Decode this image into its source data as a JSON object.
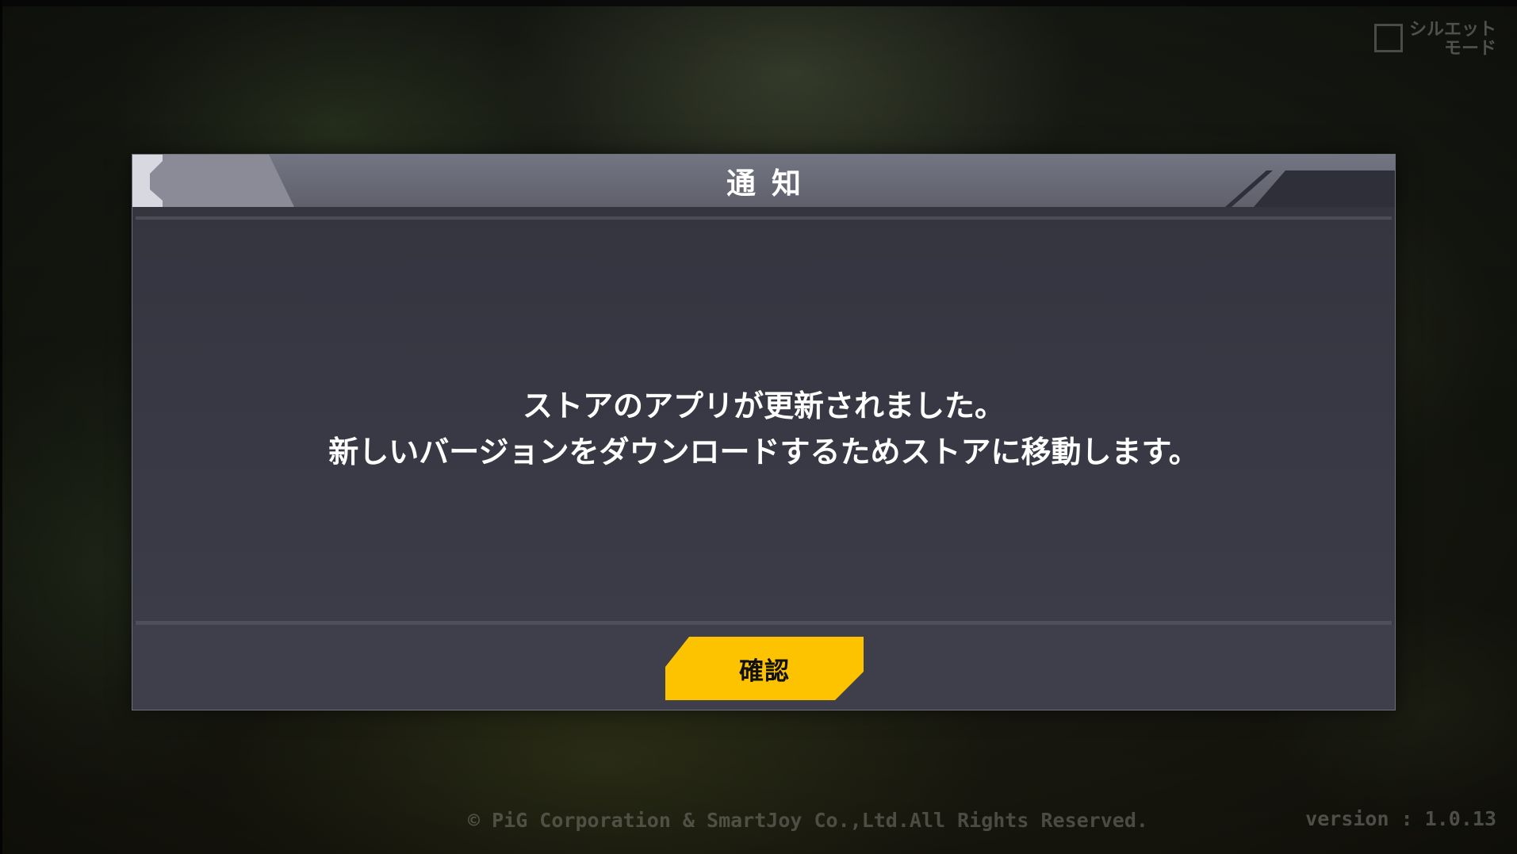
{
  "silhouette_toggle": {
    "label": "シルエット\nモード",
    "checked": false
  },
  "dialog": {
    "title": "通知",
    "message_line1": "ストアのアプリが更新されました。",
    "message_line2": "新しいバージョンをダウンロードするためストアに移動します。",
    "confirm_label": "確認"
  },
  "footer": {
    "copyright": "© PiG Corporation & SmartJoy Co.,Ltd.All Rights Reserved.",
    "version": "version : 1.0.13"
  },
  "colors": {
    "confirm_button": "#fdc300",
    "header": "#6a6b77",
    "dialog_body": "#383844"
  }
}
